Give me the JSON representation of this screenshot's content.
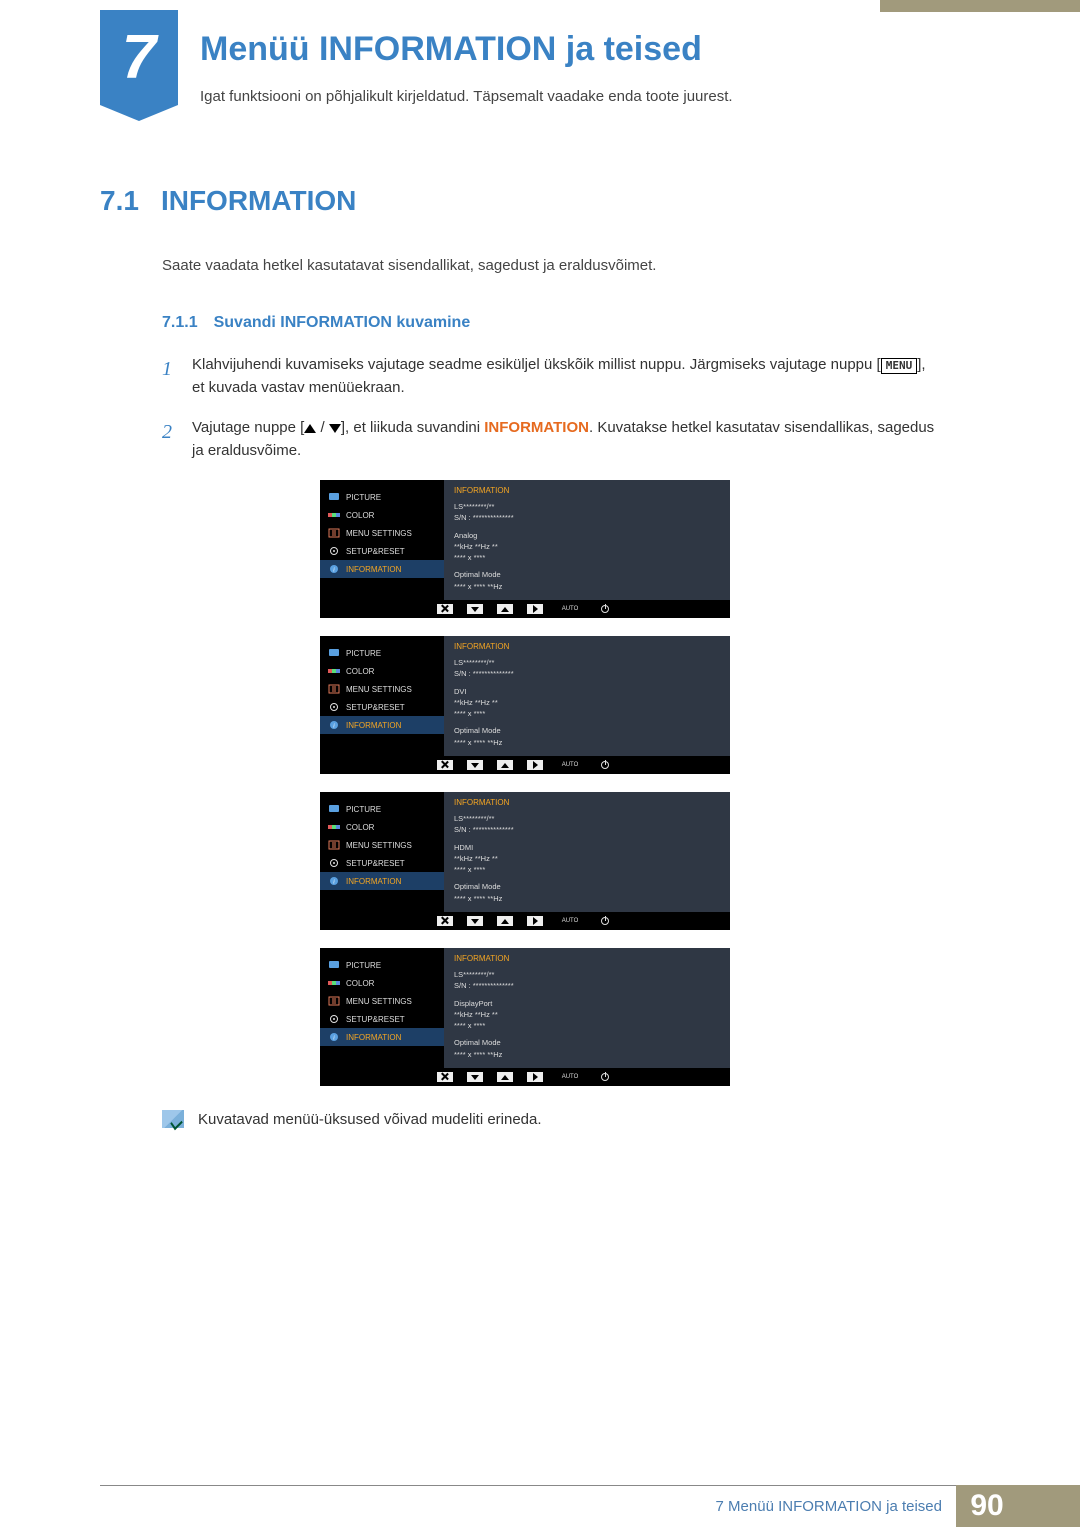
{
  "chapter": {
    "number": "7",
    "title": "Menüü INFORMATION ja teised",
    "desc": "Igat funktsiooni on põhjalikult kirjeldatud. Täpsemalt vaadake enda toote juurest."
  },
  "section": {
    "number": "7.1",
    "title": "INFORMATION",
    "lead": "Saate vaadata hetkel kasutatavat sisendallikat, sagedust ja eraldusvõimet."
  },
  "subsection": {
    "number": "7.1.1",
    "title": "Suvandi INFORMATION kuvamine"
  },
  "steps": {
    "s1_a": "Klahvijuhendi kuvamiseks vajutage seadme esiküljel ükskõik millist nuppu. Järgmiseks vajutage nuppu [",
    "s1_menu": "MENU",
    "s1_b": "], et kuvada vastav menüüekraan.",
    "s2_a": "Vajutage nuppe [",
    "s2_b": "], et liikuda suvandini ",
    "s2_info": "INFORMATION",
    "s2_c": ". Kuvatakse hetkel kasutatav sisendallikas, sagedus ja eraldusvõime."
  },
  "osd_common": {
    "panel_title": "INFORMATION",
    "menu": [
      "PICTURE",
      "COLOR",
      "MENU SETTINGS",
      "SETUP&RESET",
      "INFORMATION"
    ],
    "model": "LS********/**",
    "serial": "S/N : **************",
    "freq": "**kHz **Hz **",
    "res": "**** x ****",
    "opt_label": "Optimal Mode",
    "opt_val": "**** x **** **Hz",
    "auto": "AUTO"
  },
  "osd_variants": [
    "Analog",
    "DVI",
    "HDMI",
    "DisplayPort"
  ],
  "note": "Kuvatavad menüü-üksused võivad mudeliti erineda.",
  "footer": {
    "label": "7  Menüü INFORMATION ja teised",
    "page": "90"
  }
}
